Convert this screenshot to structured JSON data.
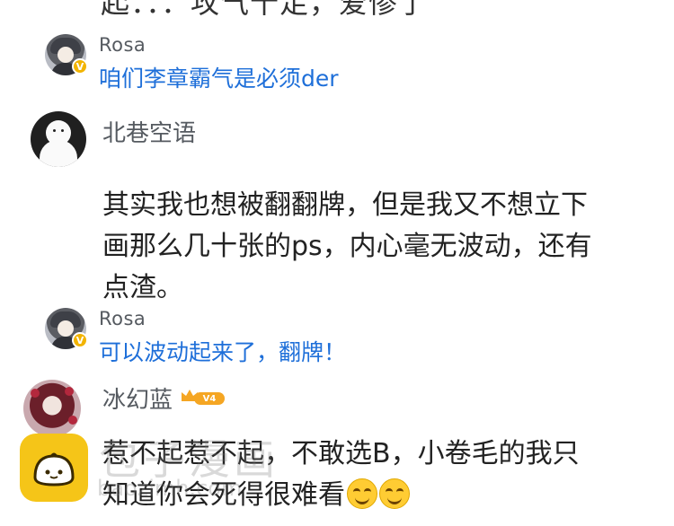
{
  "cut_off_line": "起：：：攻气十足，爱惨了",
  "replies": [
    {
      "name": "Rosa",
      "badge": "V",
      "text": "咱们李章霸气是必须der"
    },
    {
      "name": "Rosa",
      "badge": "V",
      "text": "可以波动起来了，翻牌！"
    }
  ],
  "comments": [
    {
      "name": "北巷空语",
      "lines": [
        "其实我也想被翻翻牌，但是我又不想立下",
        "画那么几十张的ps，内心毫无波动，还有",
        "点渣。"
      ]
    },
    {
      "name": "冰幻蓝",
      "vip_level": "V4",
      "lines": [
        "惹不起惹不起，不敢选B，小卷毛的我只",
        "知道你会死得很难看"
      ],
      "emojis": [
        "smile-emoji",
        "smile-emoji"
      ]
    }
  ],
  "watermark": {
    "text": "包子漫画",
    "url": "baozimh.com"
  },
  "colors": {
    "reply_text": "#1e6fd9",
    "badge": "#f2b400",
    "vip": "#f5a623",
    "logo": "#f5c518"
  }
}
